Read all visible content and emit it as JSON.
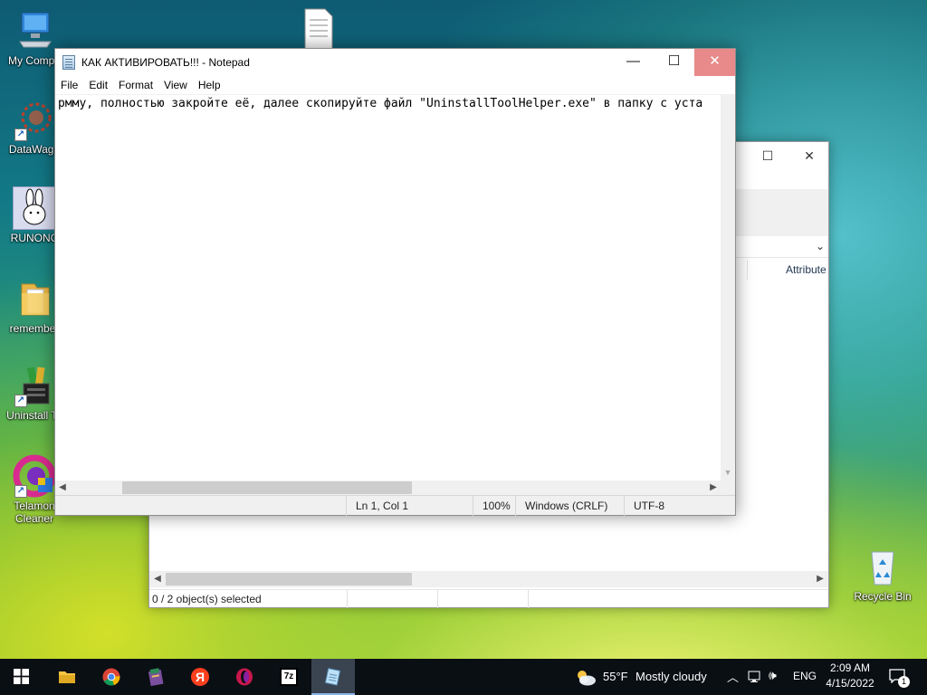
{
  "desktop": {
    "icons": [
      {
        "label": "My Compu",
        "icon": "computer-icon"
      },
      {
        "label": "DataWago",
        "icon": "datawagon-icon"
      },
      {
        "label": "RUNONC",
        "icon": "rabbit-icon"
      },
      {
        "label": "remember",
        "icon": "folder-icon"
      },
      {
        "label": "Uninstall To",
        "icon": "uninstall-tool-icon"
      },
      {
        "label": "Telamon Cleaner",
        "icon": "telamon-icon"
      },
      {
        "label": "Recycle Bin",
        "icon": "recycle-bin-icon"
      }
    ]
  },
  "explorer": {
    "column_header": "Attribute",
    "status": "0 / 2 object(s) selected"
  },
  "notepad": {
    "title": "КАК АКТИВИРОВАТЬ!!! - Notepad",
    "menu": [
      "File",
      "Edit",
      "Format",
      "View",
      "Help"
    ],
    "content": "рмму, полностью закройте её, далее скопируйте файл \"UninstallToolHelper.exe\" в папку с уста",
    "status": {
      "position": "Ln 1, Col 1",
      "zoom": "100%",
      "line_ending": "Windows (CRLF)",
      "encoding": "UTF-8"
    }
  },
  "taskbar": {
    "weather_temp": "55°F",
    "weather_desc": "Mostly cloudy",
    "language": "ENG",
    "time": "2:09 AM",
    "date": "4/15/2022",
    "notification_count": "1",
    "apps": [
      "file-explorer-icon",
      "chrome-icon",
      "winrar-icon",
      "yandex-icon",
      "opera-icon",
      "7zip-icon",
      "notepad-icon"
    ]
  }
}
